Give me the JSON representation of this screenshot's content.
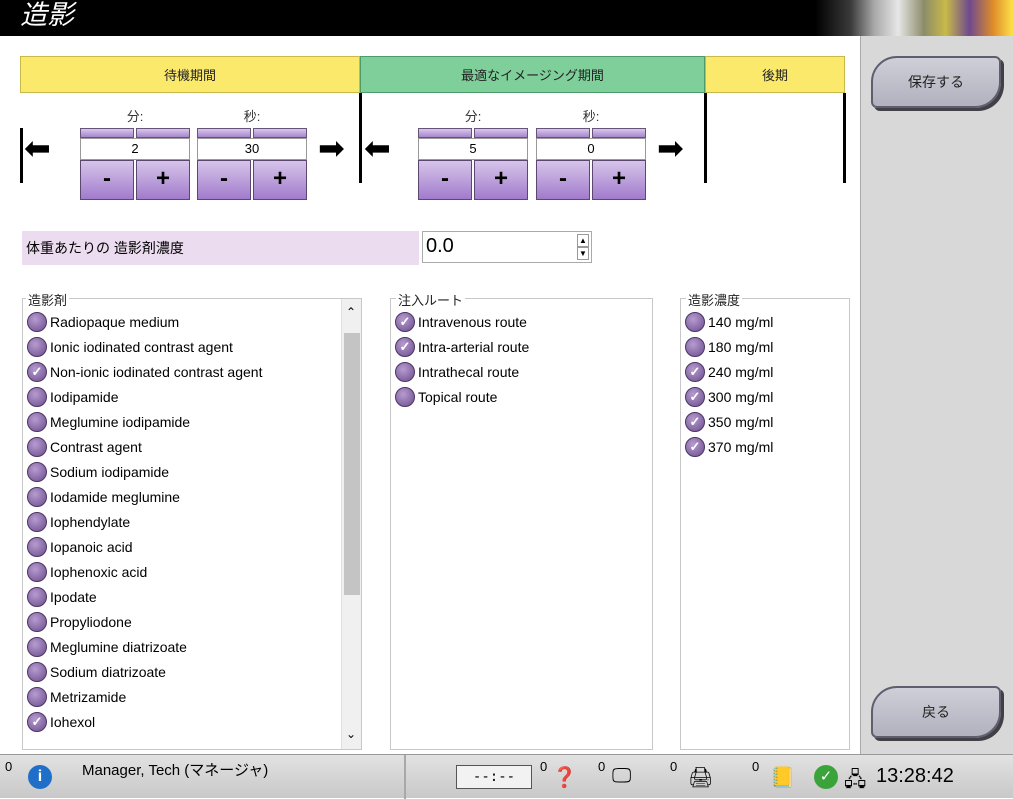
{
  "header": {
    "title": "造影"
  },
  "phases": {
    "waiting": "待機期間",
    "optimal": "最適なイメージング期間",
    "late": "後期"
  },
  "timers": {
    "min_label": "分:",
    "sec_label": "秒:",
    "wait_min": "2",
    "wait_sec": "30",
    "opt_min": "5",
    "opt_sec": "0",
    "minus": "-",
    "plus": "+"
  },
  "dose": {
    "label": "体重あたりの 造影剤濃度",
    "value": "0.0"
  },
  "agents": {
    "title": "造影剤",
    "items": [
      {
        "label": "Radiopaque medium",
        "checked": false
      },
      {
        "label": "Ionic iodinated contrast agent",
        "checked": false
      },
      {
        "label": "Non-ionic iodinated contrast agent",
        "checked": true
      },
      {
        "label": "Iodipamide",
        "checked": false
      },
      {
        "label": "Meglumine iodipamide",
        "checked": false
      },
      {
        "label": "Contrast agent",
        "checked": false
      },
      {
        "label": "Sodium iodipamide",
        "checked": false
      },
      {
        "label": "Iodamide meglumine",
        "checked": false
      },
      {
        "label": "Iophendylate",
        "checked": false
      },
      {
        "label": "Iopanoic acid",
        "checked": false
      },
      {
        "label": "Iophenoxic acid",
        "checked": false
      },
      {
        "label": "Ipodate",
        "checked": false
      },
      {
        "label": "Propyliodone",
        "checked": false
      },
      {
        "label": "Meglumine diatrizoate",
        "checked": false
      },
      {
        "label": "Sodium diatrizoate",
        "checked": false
      },
      {
        "label": "Metrizamide",
        "checked": false
      },
      {
        "label": "Iohexol",
        "checked": true
      }
    ]
  },
  "routes": {
    "title": "注入ルート",
    "items": [
      {
        "label": "Intravenous route",
        "checked": true
      },
      {
        "label": "Intra-arterial route",
        "checked": true
      },
      {
        "label": "Intrathecal route",
        "checked": false
      },
      {
        "label": "Topical route",
        "checked": false
      }
    ]
  },
  "concentration": {
    "title": "造影濃度",
    "items": [
      {
        "label": "140 mg/ml",
        "checked": false
      },
      {
        "label": "180 mg/ml",
        "checked": false
      },
      {
        "label": "240 mg/ml",
        "checked": true
      },
      {
        "label": "300 mg/ml",
        "checked": true
      },
      {
        "label": "350 mg/ml",
        "checked": true
      },
      {
        "label": "370 mg/ml",
        "checked": true
      }
    ]
  },
  "side": {
    "save": "保存する",
    "back": "戻る"
  },
  "status": {
    "alerts_count": "0",
    "user": "Manager, Tech (マネージャ)",
    "timer": "--:--",
    "count1": "0",
    "count2": "0",
    "count3": "0",
    "count4": "0",
    "time": "13:28:42"
  },
  "icons": [
    "info-icon",
    "help-icon",
    "output-icon",
    "printer-icon",
    "notes-icon",
    "check-icon",
    "network-icon"
  ],
  "colors": {
    "waiting": "#fbe96c",
    "optimal": "#7fcf9a",
    "late": "#fbe96c",
    "dose_bg": "#ecdcef",
    "button": "#b38ed6"
  }
}
